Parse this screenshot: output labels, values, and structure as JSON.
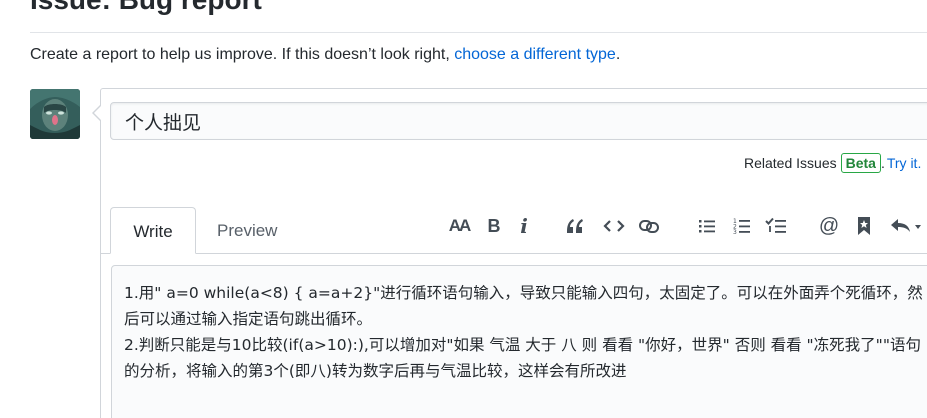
{
  "header": {
    "title": "Issue: Bug report",
    "subtitle_prefix": "Create a report to help us improve. If this doesn’t look right, ",
    "subtitle_link": "choose a different type",
    "subtitle_suffix": "."
  },
  "issue_form": {
    "title_value": "个人拙见",
    "related_label": "Related Issues",
    "beta_badge": "Beta",
    "related_sep": ".",
    "try_it_link": "Try it."
  },
  "editor": {
    "tabs": [
      {
        "label": "Write",
        "active": true
      },
      {
        "label": "Preview",
        "active": false
      }
    ],
    "toolbar": {
      "heading_glyph": "AA",
      "bold_glyph": "B",
      "italic_glyph": "i",
      "icons": [
        "heading-icon",
        "bold-icon",
        "italic-icon",
        "quote-icon",
        "code-icon",
        "link-icon",
        "unordered-list-icon",
        "ordered-list-icon",
        "task-list-icon",
        "mention-icon",
        "saved-reply-icon",
        "reply-arrow-icon"
      ]
    },
    "body_lines": [
      "1.用\" a=0 while(a<8) { a=a+2}\"进行循环语句输入，导致只能输入四句，太固定了。可以在外面弄个死循环，然后可以通过输入指定语句跳出循环。",
      "2.判断只能是与10比较(if(a>10):),可以增加对\"如果 气温 大于 八 则 看看 \"你好，世界\" 否则 看看 \"冻死我了\"\"语句的分析，将输入的第3个(即八)转为数字后再与气温比较，这样会有所改进"
    ]
  },
  "colors": {
    "link": "#0366d6",
    "beta_border": "#28a745",
    "border": "#d1d5da",
    "text": "#24292e"
  }
}
